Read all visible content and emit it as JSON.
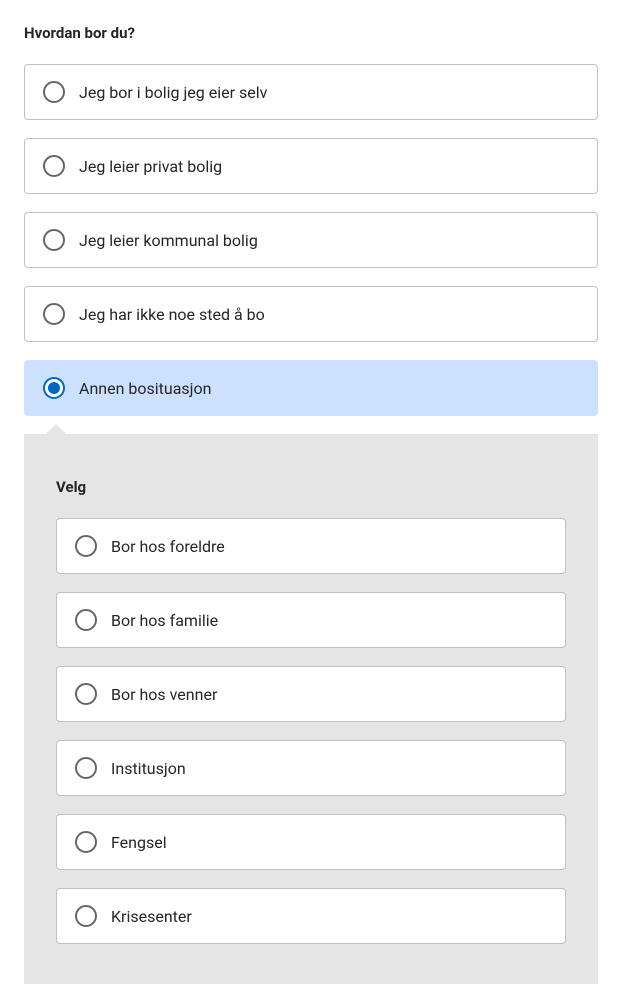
{
  "question": {
    "title": "Hvordan bor du?",
    "options": [
      {
        "label": "Jeg bor i bolig jeg eier selv",
        "selected": false
      },
      {
        "label": "Jeg leier privat bolig",
        "selected": false
      },
      {
        "label": "Jeg leier kommunal bolig",
        "selected": false
      },
      {
        "label": "Jeg har ikke noe sted å bo",
        "selected": false
      },
      {
        "label": "Annen bosituasjon",
        "selected": true
      }
    ]
  },
  "subquestion": {
    "title": "Velg",
    "options": [
      {
        "label": "Bor hos foreldre",
        "selected": false
      },
      {
        "label": "Bor hos familie",
        "selected": false
      },
      {
        "label": "Bor hos venner",
        "selected": false
      },
      {
        "label": "Institusjon",
        "selected": false
      },
      {
        "label": "Fengsel",
        "selected": false
      },
      {
        "label": "Krisesenter",
        "selected": false
      }
    ]
  }
}
